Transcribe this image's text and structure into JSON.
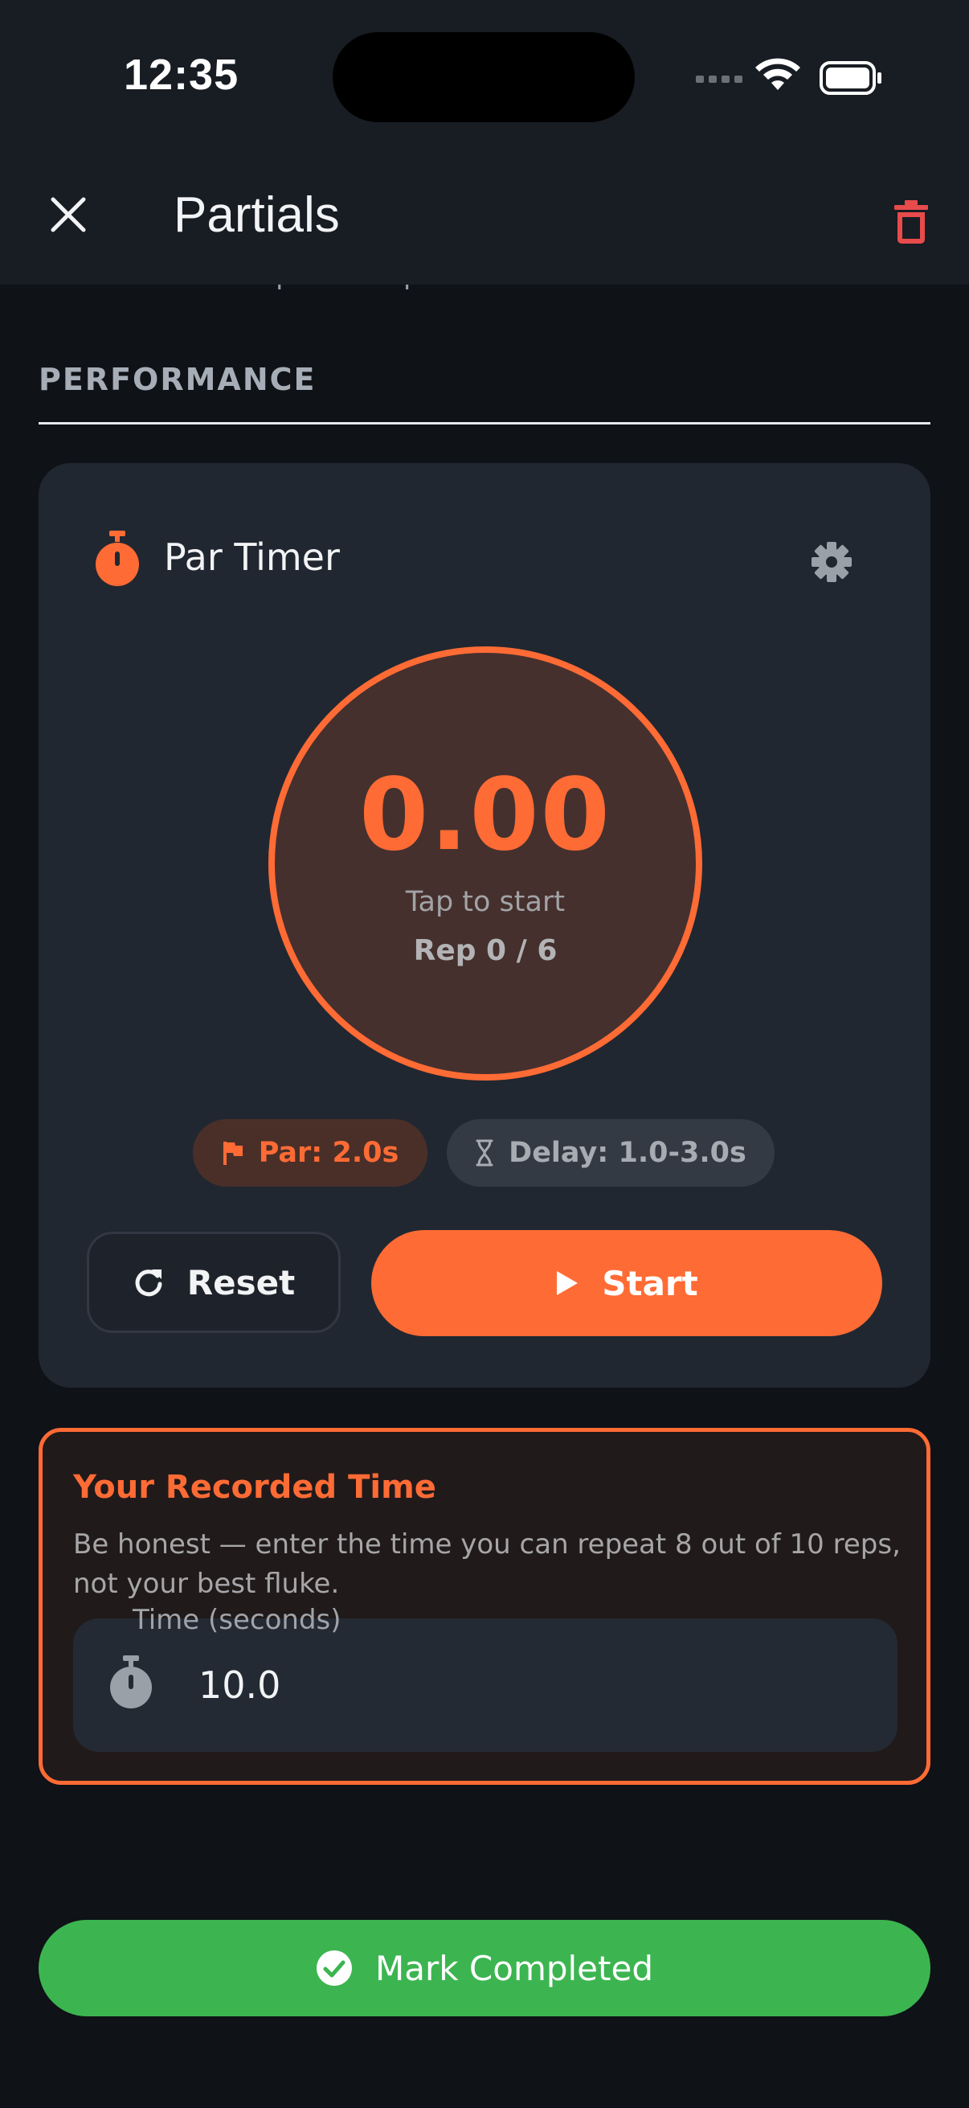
{
  "status_bar": {
    "time": "12:35"
  },
  "header": {
    "title": "Partials"
  },
  "scrolled_content": {
    "clipped_text": "Number of repetitions per set"
  },
  "performance": {
    "heading": "PERFORMANCE",
    "timer": {
      "title": "Par Timer",
      "value": "0.00",
      "hint": "Tap to start",
      "rep_label": "Rep 0 / 6",
      "par_chip": "Par: 2.0s",
      "delay_chip": "Delay: 1.0-3.0s",
      "reset_label": "Reset",
      "start_label": "Start"
    }
  },
  "recorded_time": {
    "title": "Your Recorded Time",
    "description": "Be honest — enter the time you can repeat 8 out of 10 reps, not your best fluke.",
    "field_label": "Time (seconds)",
    "field_value": "10.0"
  },
  "footer": {
    "complete_label": "Mark Completed"
  },
  "colors": {
    "accent": "#ff6b35",
    "danger": "#e84b4b",
    "success": "#3cb550",
    "background": "#0f1217",
    "card": "#212730"
  },
  "icons": {
    "close": "close-icon",
    "delete": "trash-icon",
    "timer": "stopwatch-icon",
    "settings": "gear-icon",
    "par": "flag-icon",
    "delay": "hourglass-icon",
    "reset": "refresh-icon",
    "start": "play-icon",
    "complete": "check-circle-icon"
  }
}
